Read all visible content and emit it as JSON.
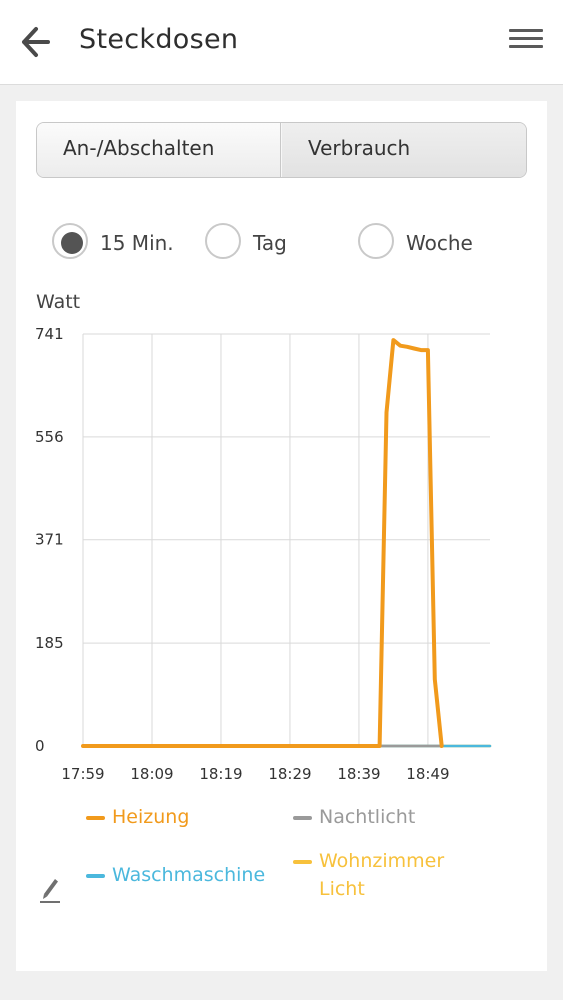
{
  "header": {
    "title": "Steckdosen",
    "back_icon": "arrow-left-icon",
    "menu_icon": "hamburger-menu-icon"
  },
  "tabs": [
    {
      "label": "An-/Abschalten",
      "selected": false
    },
    {
      "label": "Verbrauch",
      "selected": true
    }
  ],
  "range_options": [
    {
      "label": "15 Min.",
      "selected": true
    },
    {
      "label": "Tag",
      "selected": false
    },
    {
      "label": "Woche",
      "selected": false
    }
  ],
  "chart_data": {
    "type": "line",
    "ylabel": "Watt",
    "ylim": [
      0,
      741
    ],
    "y_ticks": [
      "0",
      "185",
      "371",
      "556",
      "741"
    ],
    "x_ticks": [
      "17:59",
      "18:09",
      "18:19",
      "18:29",
      "18:39",
      "18:49"
    ],
    "grid": true,
    "series": [
      {
        "name": "Heizung",
        "color": "#f19a1c",
        "x": [
          "17:59",
          "18:42",
          "18:43",
          "18:44",
          "18:45",
          "18:46",
          "18:47",
          "18:48",
          "18:49",
          "18:50",
          "18:51"
        ],
        "values": [
          0,
          0,
          600,
          730,
          720,
          718,
          715,
          712,
          712,
          120,
          0
        ]
      },
      {
        "name": "Nachtlicht",
        "color": "#9a9a9a",
        "x": [
          "17:59",
          "18:51"
        ],
        "values": [
          0,
          0
        ]
      },
      {
        "name": "Waschmaschine",
        "color": "#4bb8dd",
        "x": [
          "17:59",
          "18:58"
        ],
        "values": [
          0,
          0
        ]
      },
      {
        "name": "Wohnzimmer Licht",
        "color": "#f7c13c",
        "x": [
          "17:59",
          "18:58"
        ],
        "values": [
          0,
          0
        ]
      }
    ]
  },
  "legend": [
    {
      "label": "Heizung",
      "color": "#f19a1c"
    },
    {
      "label": "Nachtlicht",
      "color": "#9a9a9a"
    },
    {
      "label": "Waschmaschine",
      "color": "#4bb8dd"
    },
    {
      "label_line1": "Wohnzimmer",
      "label_line2": "Licht",
      "color": "#f7c13c"
    }
  ],
  "edit_icon": "pencil-icon"
}
